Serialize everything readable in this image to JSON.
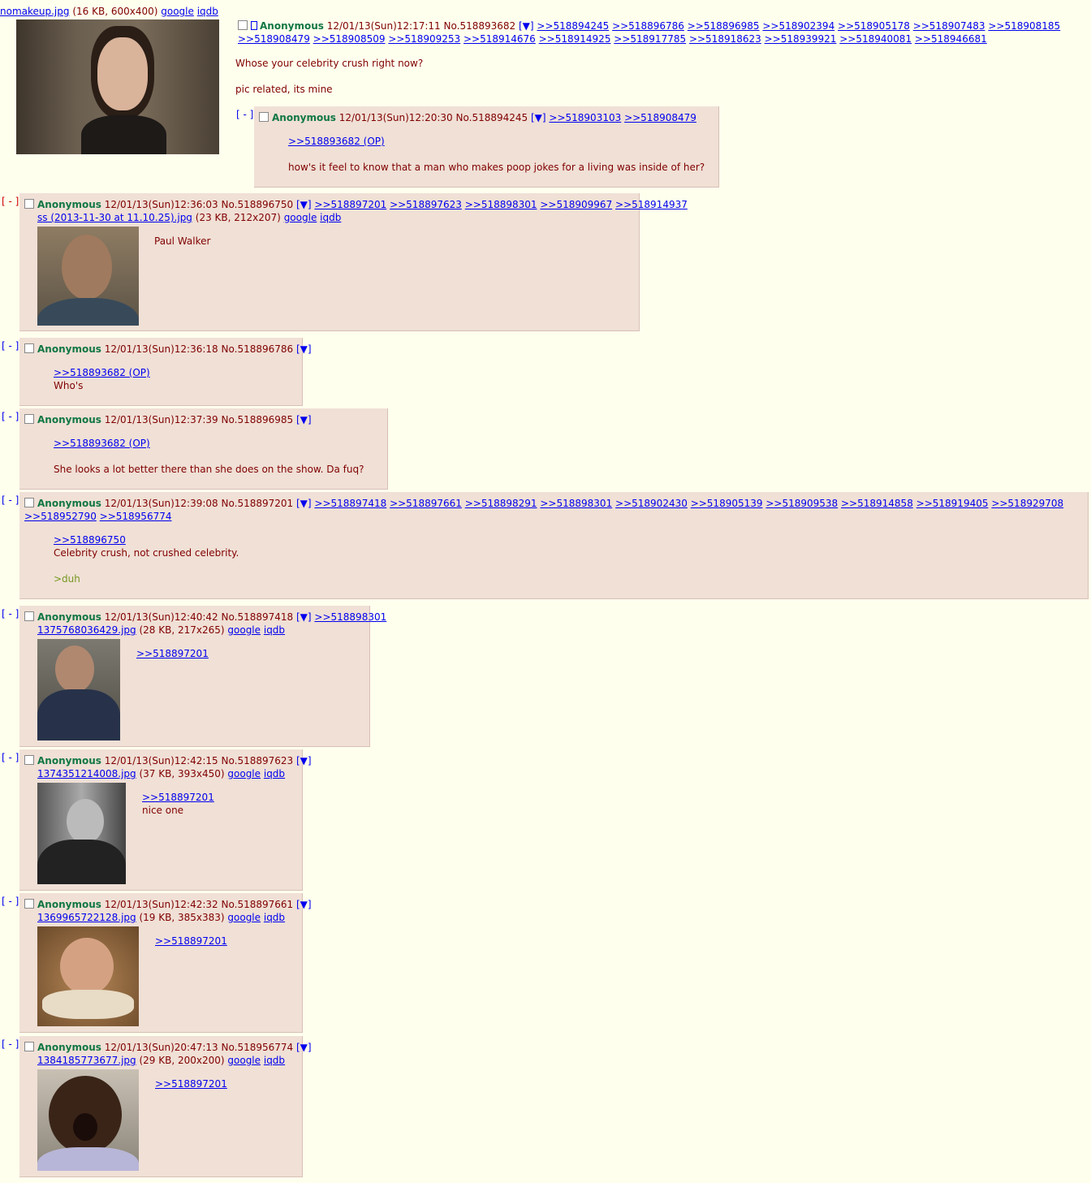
{
  "op": {
    "file_name": "nomakeup.jpg",
    "file_meta": "(16 KB, 600x400)",
    "google": "google",
    "iqdb": "iqdb",
    "name": "Anonymous",
    "datetime": "12/01/13(Sun)12:17:11",
    "no": "No.518893682",
    "menu": "[▼]",
    "backlinks": [
      ">>518894245",
      ">>518896786",
      ">>518896985",
      ">>518902394",
      ">>518905178",
      ">>518907483",
      ">>518908185",
      ">>518908479",
      ">>518908509",
      ">>518909253",
      ">>518914676",
      ">>518914925",
      ">>518917785",
      ">>518918623",
      ">>518939921",
      ">>518940081",
      ">>518946681"
    ],
    "line1": "Whose your celebrity crush right now?",
    "line2": "pic related, its mine"
  },
  "hide_label": "[ - ]",
  "replies": [
    {
      "name": "Anonymous",
      "datetime": "12/01/13(Sun)12:20:30",
      "no": "No.518894245",
      "menu": "[▼]",
      "backlinks": [
        ">>518903103",
        ">>518908479"
      ],
      "quote": ">>518893682 (OP)",
      "text": "how's it feel to know that a man who makes poop jokes for a living was inside of her?"
    },
    {
      "name": "Anonymous",
      "datetime": "12/01/13(Sun)12:36:03",
      "no": "No.518896750",
      "menu": "[▼]",
      "backlinks": [
        ">>518897201",
        ">>518897623",
        ">>518898301",
        ">>518909967",
        ">>518914937"
      ],
      "file_name": "ss (2013-11-30 at 11.10.25).jpg",
      "file_meta": "(23 KB, 212x207)",
      "text": "Paul Walker"
    },
    {
      "name": "Anonymous",
      "datetime": "12/01/13(Sun)12:36:18",
      "no": "No.518896786",
      "menu": "[▼]",
      "quote": ">>518893682 (OP)",
      "text": "Who's"
    },
    {
      "name": "Anonymous",
      "datetime": "12/01/13(Sun)12:37:39",
      "no": "No.518896985",
      "menu": "[▼]",
      "quote": ">>518893682 (OP)",
      "text": "She looks a lot better there than she does on the show. Da fuq?"
    },
    {
      "name": "Anonymous",
      "datetime": "12/01/13(Sun)12:39:08",
      "no": "No.518897201",
      "menu": "[▼]",
      "backlinks": [
        ">>518897418",
        ">>518897661",
        ">>518898291",
        ">>518898301",
        ">>518902430",
        ">>518905139",
        ">>518909538",
        ">>518914858",
        ">>518919405",
        ">>518929708",
        ">>518952790",
        ">>518956774"
      ],
      "quote": ">>518896750",
      "text": "Celebrity crush, not crushed celebrity.",
      "greentext": ">duh"
    },
    {
      "name": "Anonymous",
      "datetime": "12/01/13(Sun)12:40:42",
      "no": "No.518897418",
      "menu": "[▼]",
      "backlinks": [
        ">>518898301"
      ],
      "file_name": "1375768036429.jpg",
      "file_meta": "(28 KB, 217x265)",
      "quote": ">>518897201"
    },
    {
      "name": "Anonymous",
      "datetime": "12/01/13(Sun)12:42:15",
      "no": "No.518897623",
      "menu": "[▼]",
      "file_name": "1374351214008.jpg",
      "file_meta": "(37 KB, 393x450)",
      "quote": ">>518897201",
      "text": "nice one"
    },
    {
      "name": "Anonymous",
      "datetime": "12/01/13(Sun)12:42:32",
      "no": "No.518897661",
      "menu": "[▼]",
      "file_name": "1369965722128.jpg",
      "file_meta": "(19 KB, 385x383)",
      "quote": ">>518897201"
    },
    {
      "name": "Anonymous",
      "datetime": "12/01/13(Sun)20:47:13",
      "no": "No.518956774",
      "menu": "[▼]",
      "file_name": "1384185773677.jpg",
      "file_meta": "(29 KB, 200x200)",
      "quote": ">>518897201"
    }
  ],
  "colors": {
    "background": "#ffffee",
    "reply_background": "#f0e0d6",
    "name": "#117743",
    "text": "#800000",
    "link": "#0000ee",
    "greentext": "#789922"
  }
}
